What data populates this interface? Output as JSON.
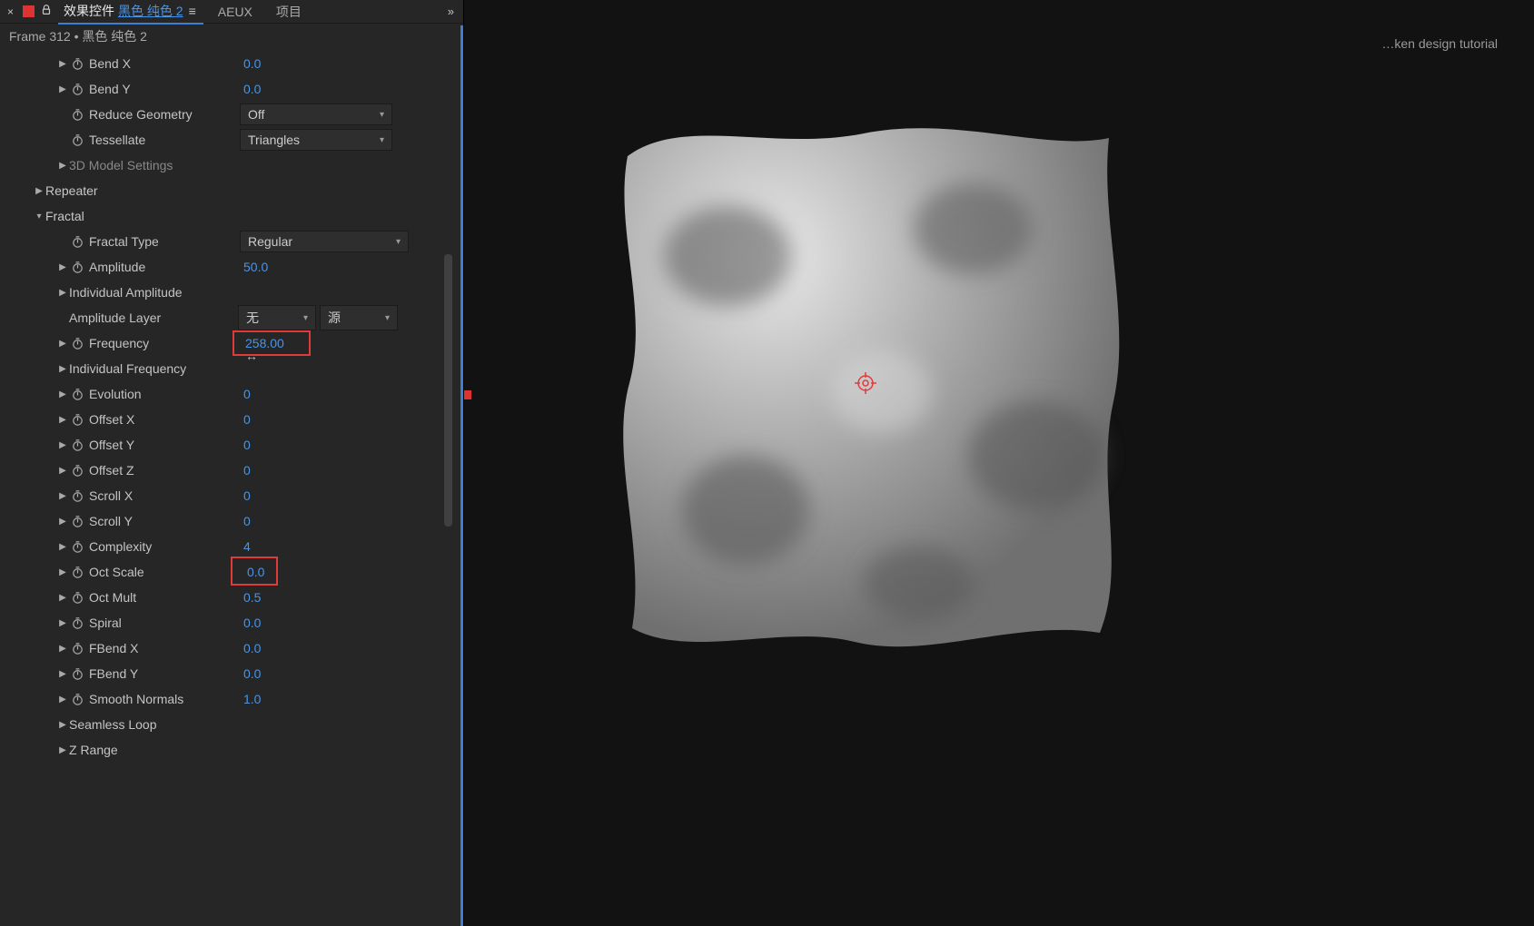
{
  "tabs": {
    "close": "×",
    "activePrefix": "效果控件",
    "activeLayer": "黑色 纯色 2",
    "menu": "≡",
    "aeux": "AEUX",
    "project": "项目",
    "expand": "»"
  },
  "breadcrumb": "Frame 312 • 黑色 纯色 2",
  "props": {
    "bendX": {
      "label": "Bend X",
      "value": "0.0"
    },
    "bendY": {
      "label": "Bend Y",
      "value": "0.0"
    },
    "reduceGeometry": {
      "label": "Reduce Geometry",
      "value": "Off"
    },
    "tessellate": {
      "label": "Tessellate",
      "value": "Triangles"
    },
    "modelSettings": {
      "label": "3D Model Settings"
    },
    "repeater": {
      "label": "Repeater"
    },
    "fractal": {
      "label": "Fractal",
      "type": {
        "label": "Fractal Type",
        "value": "Regular"
      },
      "amplitude": {
        "label": "Amplitude",
        "value": "50.0"
      },
      "individualAmplitude": {
        "label": "Individual Amplitude"
      },
      "amplitudeLayer": {
        "label": "Amplitude Layer",
        "value1": "无",
        "value2": "源"
      },
      "frequency": {
        "label": "Frequency",
        "value": "258.00"
      },
      "individualFrequency": {
        "label": "Individual Frequency"
      },
      "evolution": {
        "label": "Evolution",
        "value": "0"
      },
      "offsetX": {
        "label": "Offset X",
        "value": "0"
      },
      "offsetY": {
        "label": "Offset Y",
        "value": "0"
      },
      "offsetZ": {
        "label": "Offset Z",
        "value": "0"
      },
      "scrollX": {
        "label": "Scroll X",
        "value": "0"
      },
      "scrollY": {
        "label": "Scroll Y",
        "value": "0"
      },
      "complexity": {
        "label": "Complexity",
        "value": "4"
      },
      "octScale": {
        "label": "Oct Scale",
        "value": "0.0"
      },
      "octMult": {
        "label": "Oct Mult",
        "value": "0.5"
      },
      "spiral": {
        "label": "Spiral",
        "value": "0.0"
      },
      "fbendX": {
        "label": "FBend X",
        "value": "0.0"
      },
      "fbendY": {
        "label": "FBend Y",
        "value": "0.0"
      },
      "smoothNormals": {
        "label": "Smooth Normals",
        "value": "1.0"
      },
      "seamlessLoop": {
        "label": "Seamless Loop"
      },
      "zRange": {
        "label": "Z Range"
      }
    }
  },
  "viewport": {
    "title": "…ken design tutorial"
  }
}
